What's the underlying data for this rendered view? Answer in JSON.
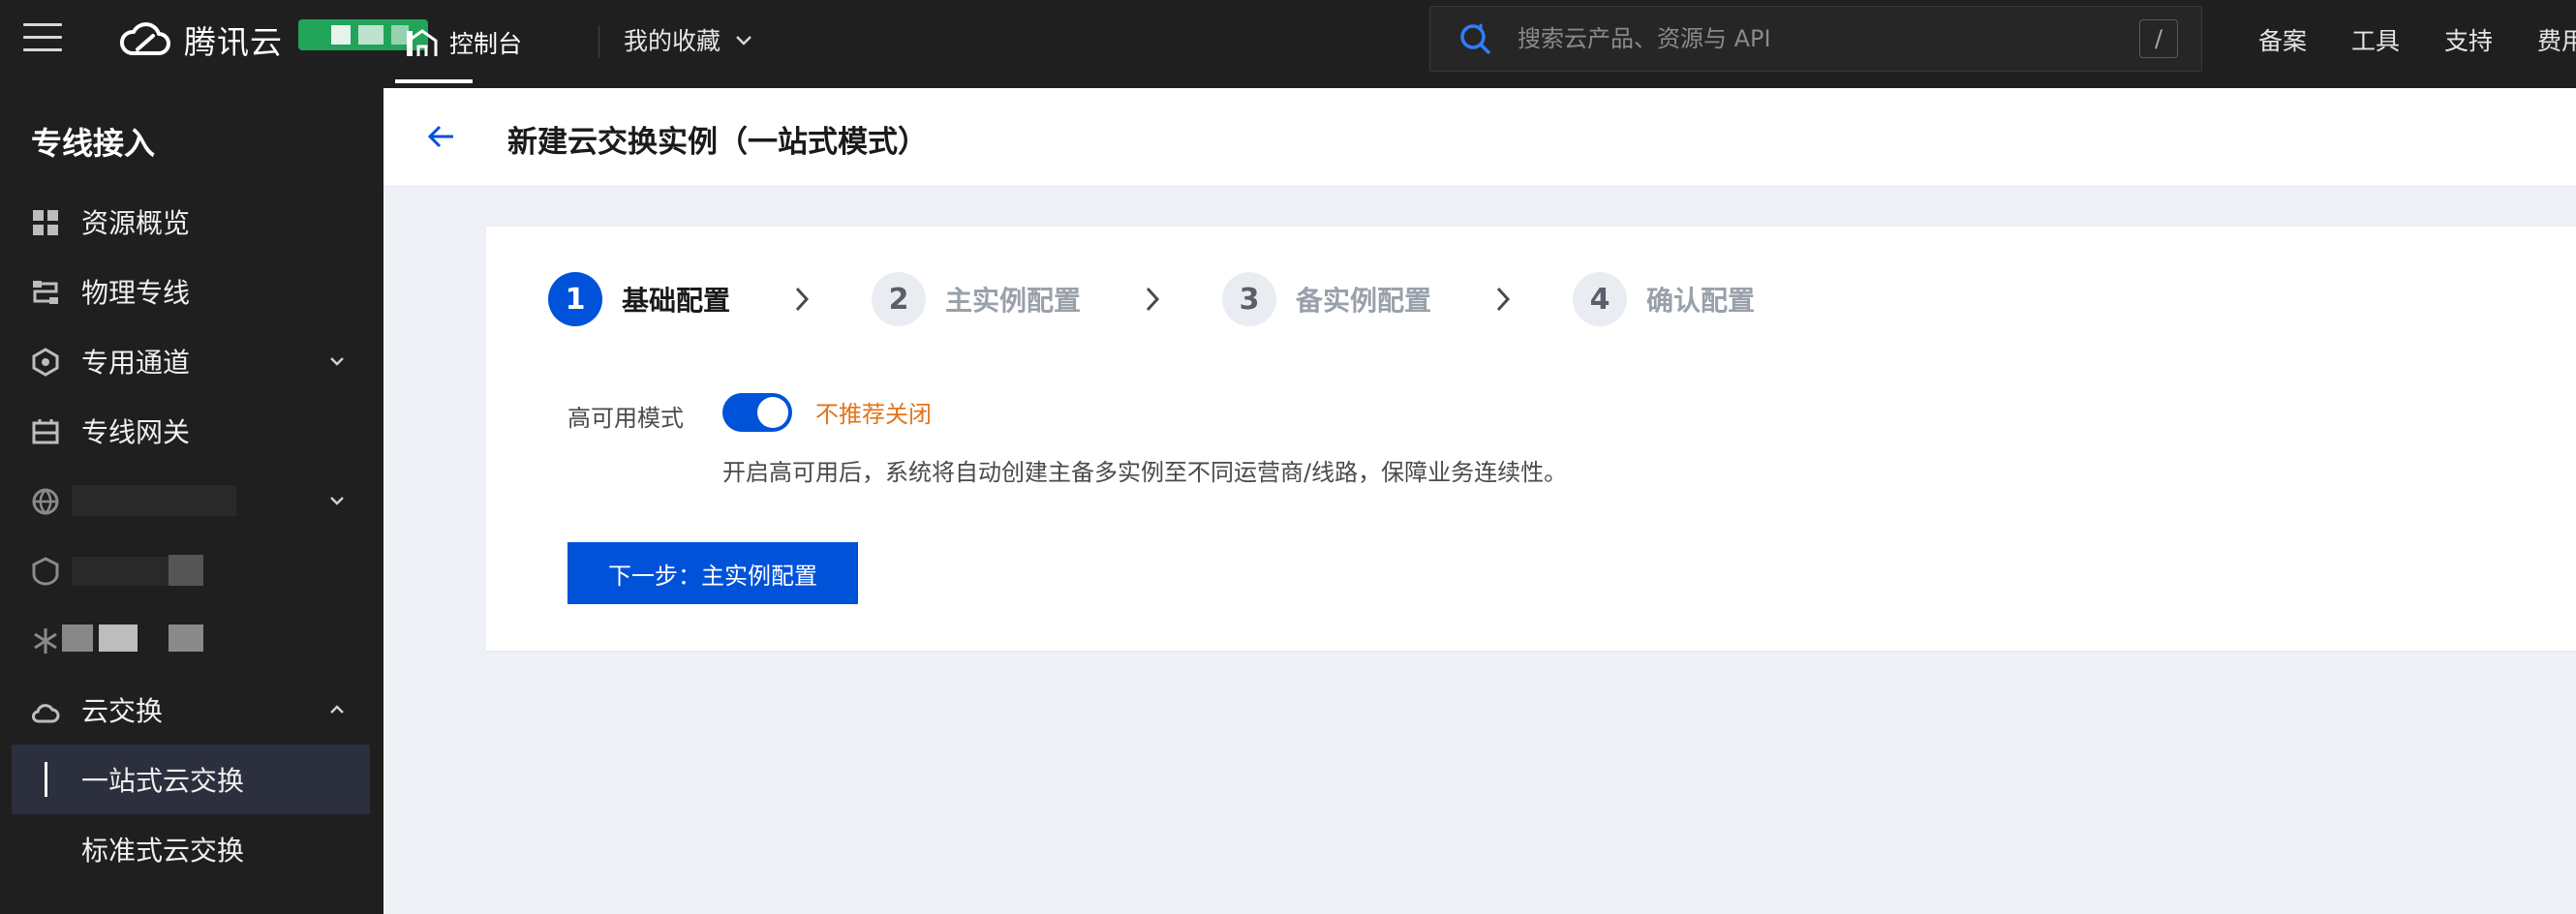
{
  "topbar": {
    "logo_text": "腾讯云",
    "console_label": "控制台",
    "favorites_label": "我的收藏",
    "search_placeholder": "搜索云产品、资源与 API",
    "search_shortcut": "/",
    "links": [
      "备案",
      "工具",
      "支持",
      "费用"
    ]
  },
  "sidebar": {
    "title": "专线接入",
    "items": [
      {
        "label": "资源概览",
        "icon": "grid-icon"
      },
      {
        "label": "物理专线",
        "icon": "network-icon"
      },
      {
        "label": "专用通道",
        "icon": "hexagon-icon",
        "expandable": true
      },
      {
        "label": "专线网关",
        "icon": "gateway-icon"
      },
      {
        "label": "",
        "icon": "globe-icon",
        "expandable": true
      },
      {
        "label": "",
        "icon": "shield-icon"
      },
      {
        "label": "",
        "icon": "snowflake-icon"
      },
      {
        "label": "云交换",
        "icon": "cloud-icon",
        "expanded": true
      }
    ],
    "sub_items": [
      {
        "label": "一站式云交换",
        "active": true
      },
      {
        "label": "标准式云交换"
      }
    ]
  },
  "page": {
    "title": "新建云交换实例（一站式模式）",
    "steps": [
      {
        "num": "1",
        "label": "基础配置",
        "state": "active"
      },
      {
        "num": "2",
        "label": "主实例配置",
        "state": "todo"
      },
      {
        "num": "3",
        "label": "备实例配置",
        "state": "todo"
      },
      {
        "num": "4",
        "label": "确认配置",
        "state": "todo"
      }
    ],
    "ha_label": "高可用模式",
    "ha_enabled": true,
    "ha_warning": "不推荐关闭",
    "ha_desc": "开启高可用后，系统将自动创建主备多实例至不同运营商/线路，保障业务连续性。",
    "next_button": "下一步：主实例配置"
  },
  "colors": {
    "primary": "#0052d9",
    "warning": "#e37318",
    "nav_bg": "#1f1f1f"
  }
}
